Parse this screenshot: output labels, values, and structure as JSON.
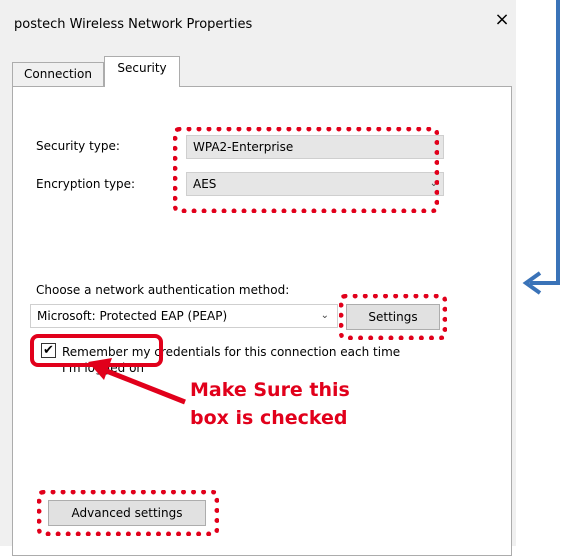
{
  "window": {
    "title": "postech Wireless Network Properties",
    "close_glyph": "×"
  },
  "tabs": [
    {
      "label": "Connection"
    },
    {
      "label": "Security"
    }
  ],
  "security": {
    "security_type_label": "Security type:",
    "security_type_value": "WPA2-Enterprise",
    "encryption_type_label": "Encryption type:",
    "encryption_type_value": "AES",
    "auth_method_label": "Choose a network authentication method:",
    "auth_method_value": "Microsoft: Protected EAP (PEAP)",
    "settings_button": "Settings",
    "remember_label": "Remember my credentials for this connection each time I'm logged on",
    "remember_checked": true,
    "advanced_button": "Advanced settings"
  },
  "annotation": {
    "line1": "Make Sure this",
    "line2": "box is checked"
  },
  "colors": {
    "highlight": "#e1001b",
    "arrow_blue": "#3a73b8"
  }
}
